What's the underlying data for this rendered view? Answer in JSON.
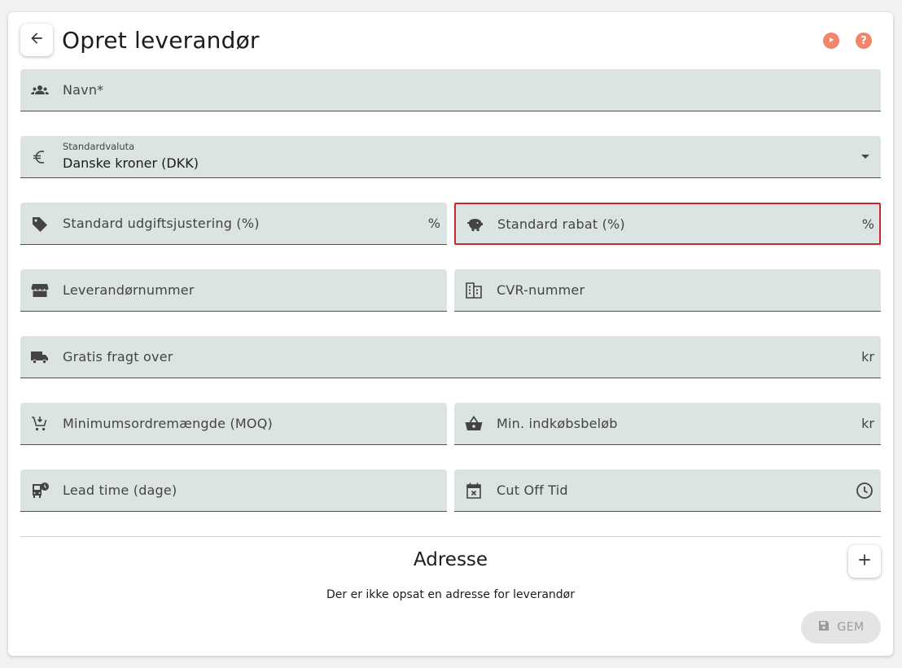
{
  "header": {
    "title": "Opret leverandør"
  },
  "fields": {
    "navn": {
      "label": "Navn*"
    },
    "valuta": {
      "small_label": "Standardvaluta",
      "value": "Danske kroner (DKK)"
    },
    "udgift": {
      "label": "Standard udgiftsjustering (%)",
      "suffix": "%"
    },
    "rabat": {
      "label": "Standard rabat (%)",
      "suffix": "%"
    },
    "levnr": {
      "label": "Leverandørnummer"
    },
    "cvr": {
      "label": "CVR-nummer"
    },
    "fragt": {
      "label": "Gratis fragt over",
      "suffix": "kr"
    },
    "moq": {
      "label": "Minimumsordremængde (MOQ)"
    },
    "minbelob": {
      "label": "Min. indkøbsbeløb",
      "suffix": "kr"
    },
    "lead": {
      "label": "Lead time (dage)"
    },
    "cutoff": {
      "label": "Cut Off Tid"
    }
  },
  "address": {
    "title": "Adresse",
    "empty_text": "Der er ikke opsat en adresse for leverandør"
  },
  "actions": {
    "save_label": "GEM"
  },
  "colors": {
    "accent": "#f2866a",
    "field_bg": "#dbe4e2",
    "focus_border": "#c9272a"
  },
  "icons": [
    "arrow-left-icon",
    "play-icon",
    "help-icon",
    "people-icon",
    "euro-icon",
    "tag-icon",
    "piggy-bank-icon",
    "store-icon",
    "building-icon",
    "truck-icon",
    "cart-icon",
    "basket-icon",
    "bus-clock-icon",
    "calendar-x-icon",
    "clock-icon",
    "plus-icon",
    "save-icon"
  ]
}
